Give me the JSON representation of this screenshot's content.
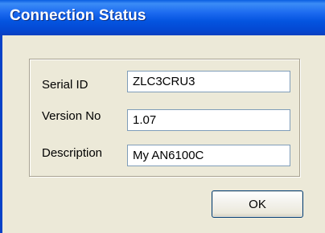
{
  "window": {
    "title": "Connection Status"
  },
  "fields": [
    {
      "label": "Serial ID",
      "value": "ZLC3CRU3"
    },
    {
      "label": "Version No",
      "value": "1.07"
    },
    {
      "label": "Description",
      "value": "My AN6100C"
    }
  ],
  "buttons": {
    "ok_label": "OK"
  }
}
